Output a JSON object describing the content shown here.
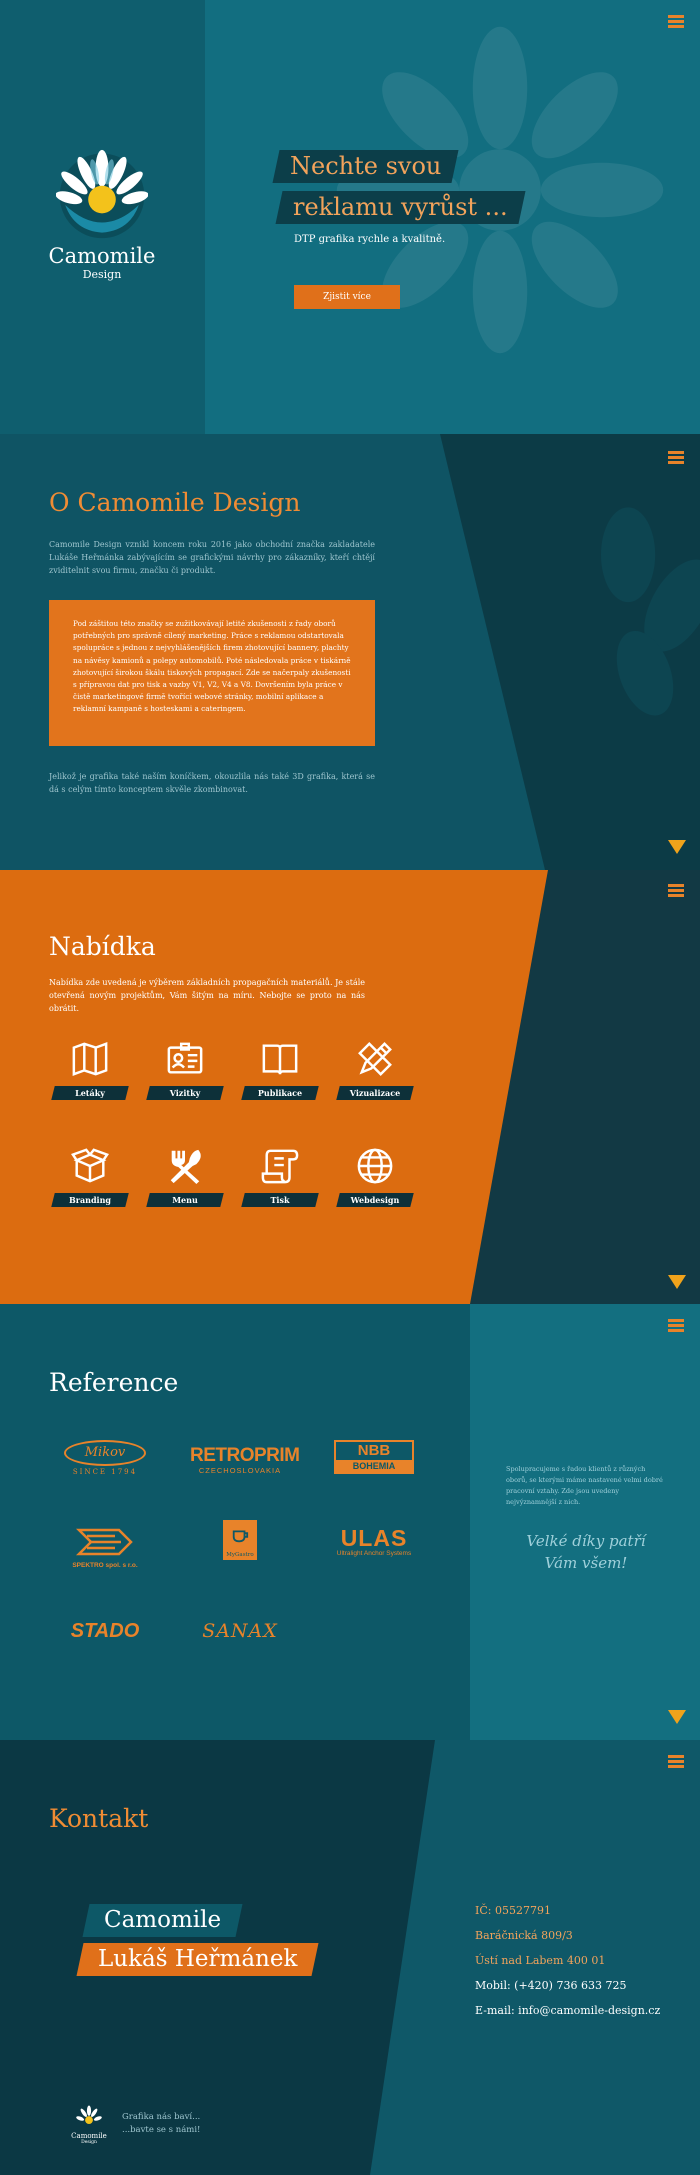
{
  "hero": {
    "logo_name": "Camomile",
    "logo_sub": "Design",
    "headline_1": "Nechte svou",
    "headline_2": "reklamu vyrůst ...",
    "subtitle": "DTP grafika rychle a kvalitně.",
    "cta": "Zjistit více"
  },
  "about": {
    "title": "O Camomile Design",
    "p1": "Camomile Design vznikl koncem roku 2016 jako obchodní značka zakladatele Lukáše Heřmánka zabývajícím se grafickými návrhy pro zákazníky, kteří chtějí zviditelnit svou firmu, značku či produkt.",
    "box": "Pod záštitou této značky se zužitkovávají letité zkušenosti z řady oborů potřebných pro správně cílený marketing. Práce s reklamou odstartovala spolupráce s jednou z nejvyhlášenějších firem zhotovující bannery, plachty na návěsy kamionů a polepy automobilů. Poté následovala práce v tiskárně zhotovující širokou škálu tiskových propagací. Zde se načerpaly zkušenosti s přípravou dat pro tisk a vazby V1, V2, V4 a V8. Dovršením byla práce v čistě marketingové firmě tvořící webové stránky, mobilní aplikace a reklamní kampaně s hosteskami a cateringem.",
    "p2": "Jelikož je grafika také naším koníčkem, okouzlila nás také 3D grafika, která se dá s celým tímto konceptem skvěle zkombinovat."
  },
  "offer": {
    "title": "Nabídka",
    "intro": "Nabídka zde uvedená je výběrem základních propagačních materiálů. Je stále otevřená novým projektům, Vám šitým na míru. Nebojte se proto na nás obrátit.",
    "services": [
      {
        "label": "Letáky",
        "icon": "map-icon"
      },
      {
        "label": "Vizitky",
        "icon": "id-card-icon"
      },
      {
        "label": "Publikace",
        "icon": "book-icon"
      },
      {
        "label": "Vizualizace",
        "icon": "pencil-ruler-icon"
      },
      {
        "label": "Branding",
        "icon": "box-icon"
      },
      {
        "label": "Menu",
        "icon": "fork-knife-icon"
      },
      {
        "label": "Tisk",
        "icon": "scroll-icon"
      },
      {
        "label": "Webdesign",
        "icon": "globe-icon"
      }
    ]
  },
  "refs": {
    "title": "Reference",
    "logos": [
      {
        "name": "Mikov",
        "sub": "SINCE 1794"
      },
      {
        "name": "RETROPRIM",
        "sub": "CZECHOSLOVAKIA"
      },
      {
        "name": "NBB",
        "sub": "BOHEMIA"
      },
      {
        "name": "SPEKTRO spol. s r.o.",
        "sub": ""
      },
      {
        "name": "MyGastro",
        "sub": ""
      },
      {
        "name": "ULAS",
        "sub": "Ultralight Anchor Systems"
      },
      {
        "name": "STADO",
        "sub": ""
      },
      {
        "name": "SANAX",
        "sub": ""
      }
    ],
    "note": "Spolupracujeme s řadou klientů z různých oborů, se kterými máme nastavené velmi dobré pracovní vztahy. Zde jsou uvedeny nejvýznamnější z nich.",
    "thanks_1": "Velké díky patří",
    "thanks_2": "Vám všem!"
  },
  "contact": {
    "title": "Kontakt",
    "ribbon_1": "Camomile",
    "ribbon_2": "Lukáš Heřmánek",
    "ic": "IČ: 05527791",
    "street": "Baráčnická 809/3",
    "city": "Ústí nad Labem  400 01",
    "mobile": "Mobil: (+420) 736 633 725",
    "email": "E-mail: info@camomile-design.cz",
    "footer_logo": "Camomile",
    "footer_logo_sub": "Design",
    "footer_1": "Grafika nás baví...",
    "footer_2": "...bavte se s námi!"
  },
  "colors": {
    "orange": "#e0701a",
    "teal": "#126e80",
    "dark": "#0c3b46"
  }
}
